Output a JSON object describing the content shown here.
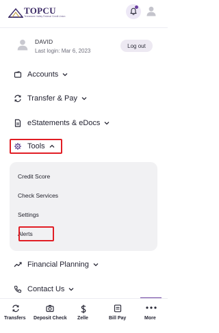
{
  "header": {
    "logo_text": "TOPCU",
    "logo_subtext": "Tennessee Valley Federal Credit Union",
    "notification_icon": "bell-icon",
    "profile_icon": "user-icon",
    "accent_color": "#6b3fa0"
  },
  "user": {
    "name": "DAVID",
    "last_login": "Last login: Mar 6, 2023",
    "logout_label": "Log out"
  },
  "menu": {
    "items": [
      {
        "label": "Accounts",
        "icon": "wallet-icon"
      },
      {
        "label": "Transfer & Pay",
        "icon": "transfer-arrows-icon"
      },
      {
        "label": "eStatements & eDocs",
        "icon": "document-icon"
      },
      {
        "label": "Tools",
        "icon": "gear-icon"
      },
      {
        "label": "Financial Planning",
        "icon": "trend-line-icon"
      },
      {
        "label": "Contact Us",
        "icon": "phone-icon"
      }
    ],
    "tools_submenu": [
      "Credit Score",
      "Check Services",
      "Settings",
      "Alerts"
    ],
    "highlight_color": "#e11d24"
  },
  "bottom_nav": {
    "items": [
      {
        "label": "Transfers",
        "icon": "transfer-icon"
      },
      {
        "label": "Deposit Check",
        "icon": "camera-icon"
      },
      {
        "label": "Zelle",
        "icon": "dollar-icon"
      },
      {
        "label": "Bill Pay",
        "icon": "bill-icon"
      },
      {
        "label": "More",
        "icon": "more-dots-icon"
      }
    ],
    "active": "More"
  }
}
